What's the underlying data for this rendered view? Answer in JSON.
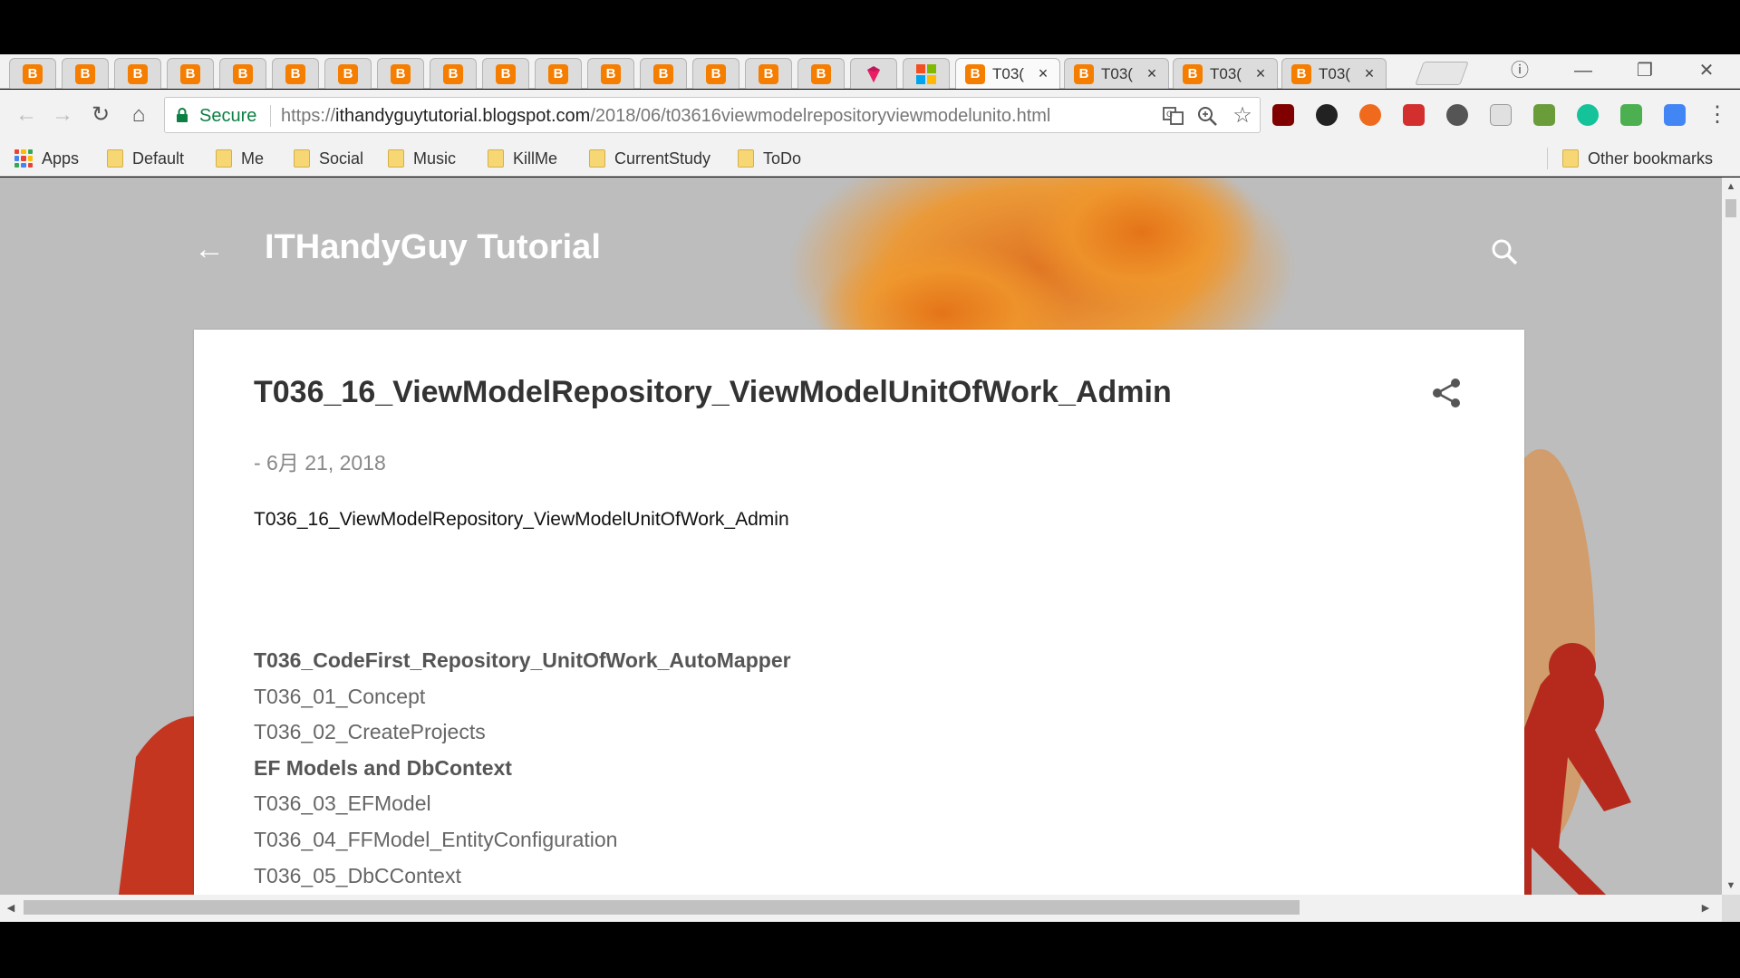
{
  "browser": {
    "tabs": [
      {
        "kind": "blogger",
        "pinned": true
      },
      {
        "kind": "blogger",
        "pinned": true
      },
      {
        "kind": "blogger",
        "pinned": true
      },
      {
        "kind": "blogger",
        "pinned": true
      },
      {
        "kind": "blogger",
        "pinned": true
      },
      {
        "kind": "blogger",
        "pinned": true
      },
      {
        "kind": "blogger",
        "pinned": true
      },
      {
        "kind": "blogger",
        "pinned": true
      },
      {
        "kind": "blogger",
        "pinned": true
      },
      {
        "kind": "blogger",
        "pinned": true
      },
      {
        "kind": "blogger",
        "pinned": true
      },
      {
        "kind": "blogger",
        "pinned": true
      },
      {
        "kind": "blogger",
        "pinned": true
      },
      {
        "kind": "blogger",
        "pinned": true
      },
      {
        "kind": "blogger",
        "pinned": true
      },
      {
        "kind": "blogger",
        "pinned": true
      },
      {
        "kind": "ruby",
        "pinned": true
      },
      {
        "kind": "microsoft",
        "pinned": true
      },
      {
        "kind": "blogger",
        "title": "T03(",
        "active": true
      },
      {
        "kind": "blogger",
        "title": "T03("
      },
      {
        "kind": "blogger",
        "title": "T03("
      },
      {
        "kind": "blogger",
        "title": "T03("
      }
    ],
    "close_glyph": "×",
    "window_controls": {
      "minimize": "—",
      "restore": "❐",
      "close": "✕"
    },
    "profile_glyph": "ⓘ"
  },
  "toolbar": {
    "back": "←",
    "forward": "→",
    "reload": "↻",
    "home": "⌂",
    "secure_label": "Secure",
    "url_scheme": "https://",
    "url_host": "ithandyguytutorial.blogspot.com",
    "url_path": "/2018/06/t03616viewmodelrepositoryviewmodelunito.html",
    "star": "☆",
    "menu": "⋮"
  },
  "bookmarks": {
    "apps": "Apps",
    "folders": [
      "Default",
      "Me",
      "Social",
      "Music",
      "KillMe",
      "CurrentStudy",
      "ToDo"
    ],
    "other": "Other bookmarks"
  },
  "blog": {
    "back_arrow": "←",
    "title": "ITHandyGuy Tutorial"
  },
  "post": {
    "title": "T036_16_ViewModelRepository_ViewModelUnitOfWork_Admin",
    "date": "- 6月 21, 2018",
    "first_line": "T036_16_ViewModelRepository_ViewModelUnitOfWork_Admin",
    "items": [
      {
        "text": "T036_CodeFirst_Repository_UnitOfWork_AutoMapper",
        "heading": true
      },
      {
        "text": "T036_01_Concept",
        "heading": false
      },
      {
        "text": "T036_02_CreateProjects",
        "heading": false
      },
      {
        "text": "EF Models and DbContext",
        "heading": true
      },
      {
        "text": "T036_03_EFModel",
        "heading": false
      },
      {
        "text": "T036_04_FFModel_EntityConfiguration",
        "heading": false
      },
      {
        "text": "T036_05_DbCContext",
        "heading": false
      }
    ]
  },
  "scroll": {
    "up": "▲",
    "down": "▼",
    "left": "◀",
    "right": "▶"
  },
  "colors": {
    "blogger": "#f57d00",
    "secure": "#0b8043",
    "tree_orange": "#e07a1f",
    "figure_red": "#b52a1c"
  }
}
